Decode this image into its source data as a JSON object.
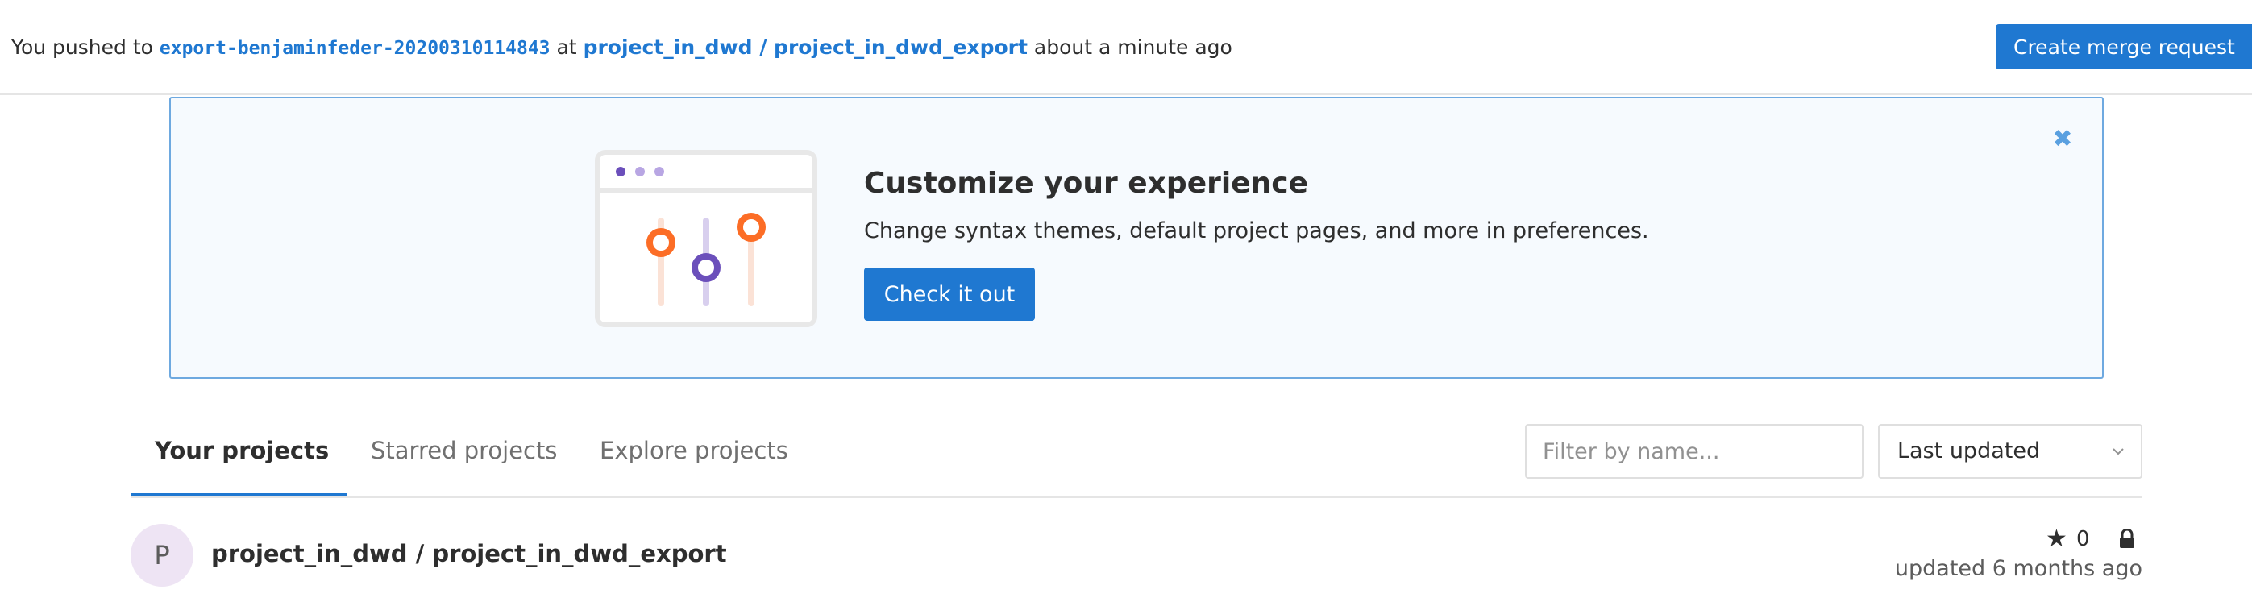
{
  "push_bar": {
    "prefix": "You pushed to",
    "branch": "export-benjaminfeder-20200310114843",
    "at": "at",
    "project": "project_in_dwd / project_in_dwd_export",
    "time": "about a minute ago",
    "button": "Create merge request"
  },
  "callout": {
    "title": "Customize your experience",
    "description": "Change syntax themes, default project pages, and more in preferences.",
    "button": "Check it out",
    "close_icon": "close-icon"
  },
  "tabs": [
    {
      "label": "Your projects",
      "active": true
    },
    {
      "label": "Starred projects",
      "active": false
    },
    {
      "label": "Explore projects",
      "active": false
    }
  ],
  "filter": {
    "placeholder": "Filter by name..."
  },
  "sort": {
    "selected": "Last updated"
  },
  "projects": [
    {
      "avatar_letter": "P",
      "name": "project_in_dwd / project_in_dwd_export",
      "stars": "0",
      "updated": "updated 6 months ago",
      "visibility_icon": "lock-icon"
    }
  ],
  "colors": {
    "accent": "#1f78d1",
    "banner_bg": "#f6fafe",
    "orange": "#fc6d26",
    "purple": "#6b4fbb"
  }
}
